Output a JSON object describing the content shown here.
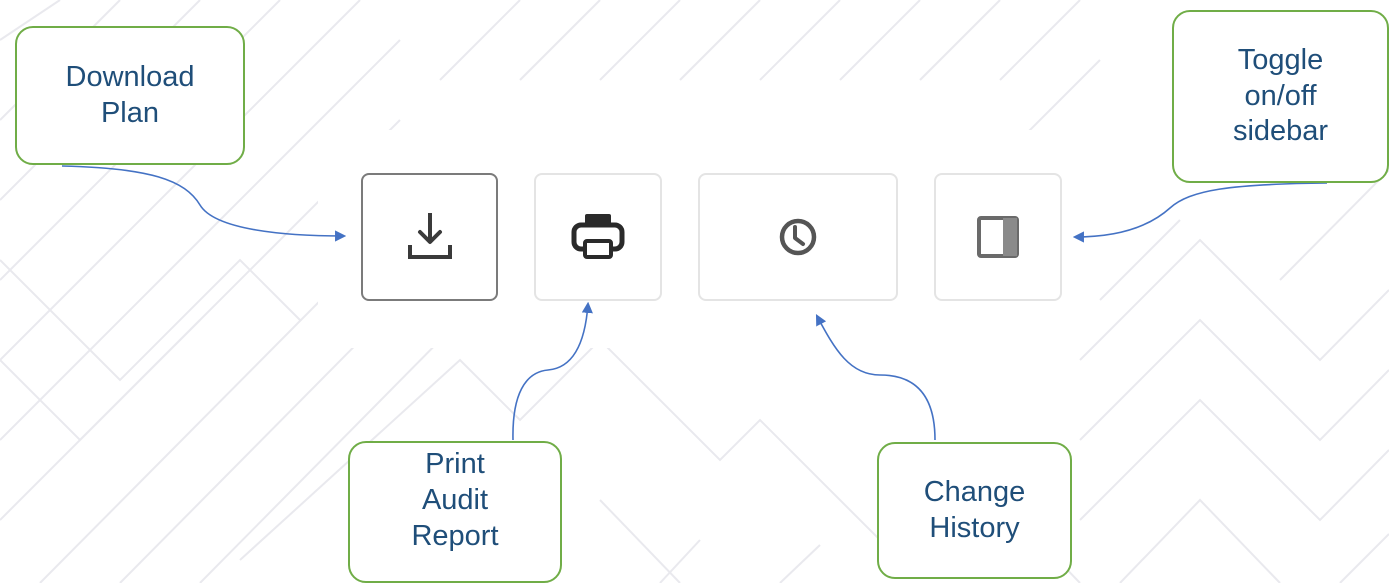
{
  "toolbar": {
    "buttons": [
      {
        "name": "download-plan-button",
        "icon": "download-icon"
      },
      {
        "name": "print-audit-report-button",
        "icon": "printer-icon"
      },
      {
        "name": "change-history-button",
        "icon": "clock-icon"
      },
      {
        "name": "toggle-sidebar-button",
        "icon": "sidebar-panel-icon"
      }
    ]
  },
  "callouts": {
    "download_plan": "Download\nPlan",
    "print_audit_report": "Print\nAudit\nReport",
    "change_history": "Change\nHistory",
    "toggle_sidebar": "Toggle\non/off\nsidebar"
  },
  "colors": {
    "callout_border": "#70ad47",
    "callout_text": "#1f4e79",
    "arrow": "#4472c4",
    "button_border": "#e4e4e4",
    "active_border": "#7b7b7b",
    "icon": "#3a3a3a"
  }
}
